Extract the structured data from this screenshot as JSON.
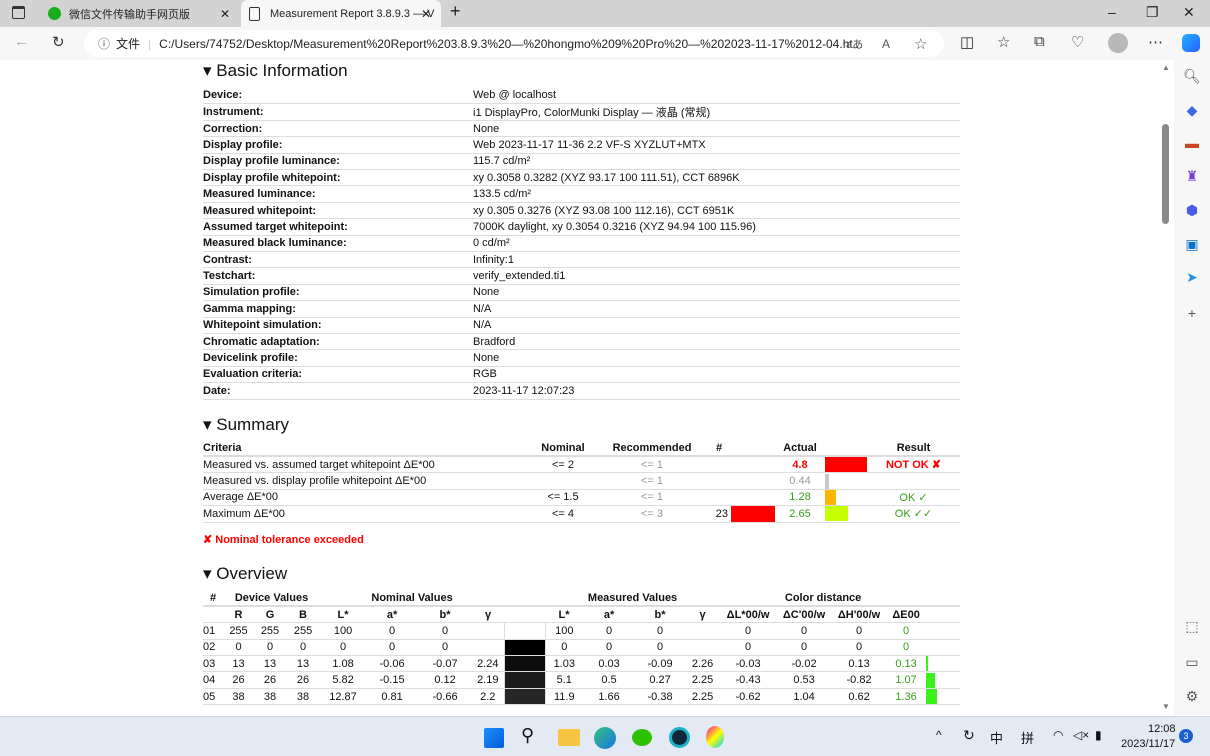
{
  "browser": {
    "tabs": [
      {
        "label": "微信文件传输助手网页版",
        "icon": "wechat-icon"
      },
      {
        "label": "Measurement Report 3.8.9.3 — V",
        "icon": "file-icon",
        "active": true
      }
    ],
    "address_label": "文件",
    "url": "C:/Users/74752/Desktop/Measurement%20Report%203.8.9.3%20—%20hongmo%209%20Pro%20—%202023-11-17%2012-04.ht...",
    "read_aloud": "aあ"
  },
  "basic": {
    "title": "Basic Information",
    "rows": [
      {
        "label": "Device:",
        "value": "Web @ localhost"
      },
      {
        "label": "Instrument:",
        "value": "i1 DisplayPro, ColorMunki Display — 液晶 (常规)"
      },
      {
        "label": "Correction:",
        "value": "None"
      },
      {
        "label": "Display profile:",
        "value": "Web 2023-11-17 11-36 2.2 VF-S XYZLUT+MTX"
      },
      {
        "label": "Display profile luminance:",
        "value": "115.7 cd/m²"
      },
      {
        "label": "Display profile whitepoint:",
        "value": "xy 0.3058 0.3282 (XYZ 93.17 100 111.51), CCT 6896K"
      },
      {
        "label": "Measured luminance:",
        "value": "133.5 cd/m²"
      },
      {
        "label": "Measured whitepoint:",
        "value": "xy 0.305 0.3276 (XYZ 93.08 100 112.16), CCT 6951K"
      },
      {
        "label": "Assumed target whitepoint:",
        "value": "7000K daylight, xy 0.3054 0.3216 (XYZ 94.94 100 115.96)"
      },
      {
        "label": "Measured black luminance:",
        "value": "0 cd/m²"
      },
      {
        "label": "Contrast:",
        "value": "Infinity:1"
      },
      {
        "label": "Testchart:",
        "value": "verify_extended.ti1"
      },
      {
        "label": "Simulation profile:",
        "value": "None"
      },
      {
        "label": "Gamma mapping:",
        "value": "N/A"
      },
      {
        "label": "Whitepoint simulation:",
        "value": "N/A"
      },
      {
        "label": "Chromatic adaptation:",
        "value": "Bradford"
      },
      {
        "label": "Devicelink profile:",
        "value": "None"
      },
      {
        "label": "Evaluation criteria:",
        "value": "RGB"
      },
      {
        "label": "Date:",
        "value": "2023-11-17 12:07:23"
      }
    ]
  },
  "summary": {
    "title": "Summary",
    "headers": [
      "Criteria",
      "Nominal",
      "Recommended",
      "#",
      "Actual",
      "Result"
    ],
    "rows": [
      {
        "criteria": "Measured vs. assumed target whitepoint ΔE*00",
        "nominal": "<= 2",
        "recommended": "<= 1",
        "num": "",
        "actual": "4.8",
        "actual_color": "#ff0000",
        "bar_color": "#ff0000",
        "bar_fraction": 1.0,
        "result": "NOT OK ✘",
        "result_color": "#ff0000"
      },
      {
        "criteria": "Measured vs. display profile whitepoint ΔE*00",
        "nominal": "",
        "recommended": "<= 1",
        "num": "",
        "actual": "0.44",
        "actual_color": "#999999",
        "bar_color": "#c8c8c8",
        "bar_fraction": 0.1,
        "result": "",
        "result_color": "#3a9c1a"
      },
      {
        "criteria": "Average ΔE*00",
        "nominal": "<= 1.5",
        "recommended": "<= 1",
        "num": "",
        "actual": "1.28",
        "actual_color": "#3a9c1a",
        "bar_color": "#ffb400",
        "bar_fraction": 0.27,
        "result": "OK ✓",
        "result_color": "#3a9c1a"
      },
      {
        "criteria": "Maximum ΔE*00",
        "nominal": "<= 4",
        "recommended": "<= 3",
        "num": "23",
        "actual": "2.65",
        "actual_color": "#3a9c1a",
        "bar_color": "#c8ff00",
        "bar_fraction": 0.55,
        "result": "OK ✓✓",
        "result_color": "#3a9c1a",
        "num_swatch": "#ff0000"
      }
    ],
    "note": "✘ Nominal tolerance exceeded"
  },
  "overview": {
    "title": "Overview",
    "groups": {
      "num": "#",
      "device": "Device Values",
      "nominal": "Nominal Values",
      "measured": "Measured Values",
      "distance": "Color distance"
    },
    "columns": [
      "R",
      "G",
      "B",
      "L*",
      "a*",
      "b*",
      "γ",
      "L*",
      "a*",
      "b*",
      "γ",
      "ΔL*00/w",
      "ΔC'00/w",
      "ΔH'00/w",
      "ΔE00"
    ],
    "rows": [
      {
        "n": "01",
        "rgb": [
          "255",
          "255",
          "255"
        ],
        "nom": [
          "100",
          "0",
          "0",
          ""
        ],
        "swatch": "#ffffff",
        "meas": [
          "100",
          "0",
          "0",
          ""
        ],
        "dist": [
          "0",
          "0",
          "0"
        ],
        "de": "0",
        "de_bar": 0
      },
      {
        "n": "02",
        "rgb": [
          "0",
          "0",
          "0"
        ],
        "nom": [
          "0",
          "0",
          "0",
          ""
        ],
        "swatch": "#000000",
        "meas": [
          "0",
          "0",
          "0",
          ""
        ],
        "dist": [
          "0",
          "0",
          "0"
        ],
        "de": "0",
        "de_bar": 0
      },
      {
        "n": "03",
        "rgb": [
          "13",
          "13",
          "13"
        ],
        "nom": [
          "1.08",
          "-0.06",
          "-0.07",
          "2.24"
        ],
        "swatch": "#0d0d0d",
        "meas": [
          "1.03",
          "0.03",
          "-0.09",
          "2.26"
        ],
        "dist": [
          "-0.03",
          "-0.02",
          "0.13"
        ],
        "de": "0.13",
        "de_bar": 0.13
      },
      {
        "n": "04",
        "rgb": [
          "26",
          "26",
          "26"
        ],
        "nom": [
          "5.82",
          "-0.15",
          "0.12",
          "2.19"
        ],
        "swatch": "#1a1a1a",
        "meas": [
          "5.1",
          "0.5",
          "0.27",
          "2.25"
        ],
        "dist": [
          "-0.43",
          "0.53",
          "-0.82"
        ],
        "de": "1.07",
        "de_bar": 1.07
      },
      {
        "n": "05",
        "rgb": [
          "38",
          "38",
          "38"
        ],
        "nom": [
          "12.87",
          "0.81",
          "-0.66",
          "2.2"
        ],
        "swatch": "#262626",
        "meas": [
          "11.9",
          "1.66",
          "-0.38",
          "2.25"
        ],
        "dist": [
          "-0.62",
          "1.04",
          "0.62"
        ],
        "de": "1.36",
        "de_bar": 1.36
      }
    ]
  },
  "taskbar": {
    "time": "12:08",
    "date": "2023/11/17",
    "ime1": "中",
    "ime2": "拼",
    "badge": "3"
  }
}
